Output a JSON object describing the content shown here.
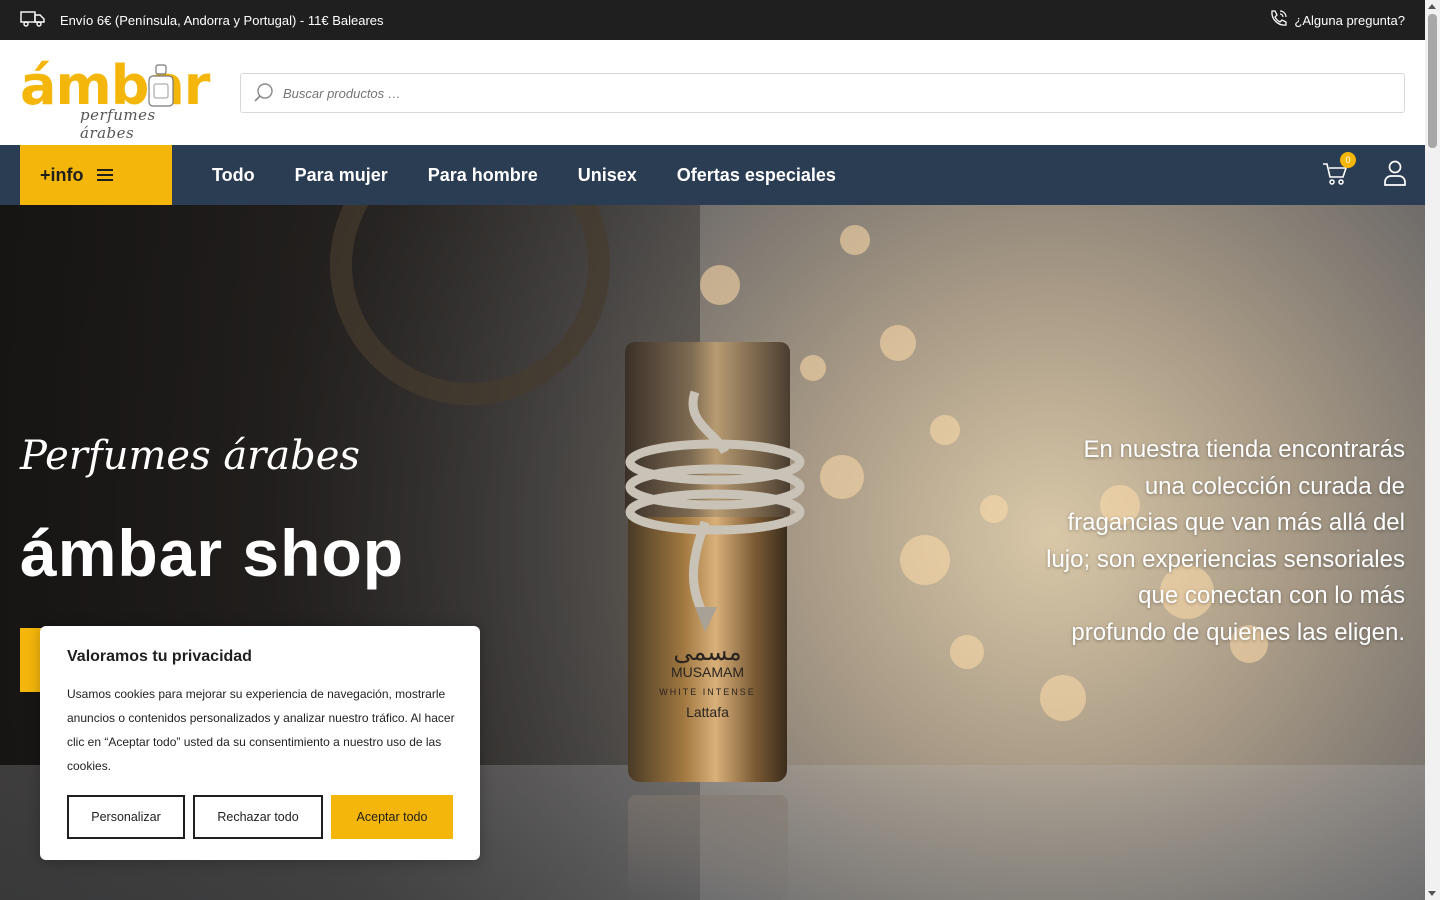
{
  "topbar": {
    "shipping_icon": "truck-icon",
    "shipping_text": "Envío 6€ (Península, Andorra y Portugal) - 11€ Baleares",
    "question_icon": "phone-icon",
    "question_text": "¿Alguna pregunta?"
  },
  "header": {
    "logo_word": "ámbar",
    "logo_tagline": "perfumes árabes",
    "search_placeholder": "Buscar productos …",
    "search_icon": "search-icon"
  },
  "nav": {
    "info_label": "+info",
    "menu_icon": "hamburger-icon",
    "items": [
      "Todo",
      "Para mujer",
      "Para hombre",
      "Unisex",
      "Ofertas especiales"
    ],
    "cart_count": "0",
    "cart_icon": "cart-icon",
    "user_icon": "user-icon"
  },
  "hero": {
    "script_text": "Perfumes árabes",
    "title": "ámbar shop",
    "description": "En nuestra tienda encontrarás una colección curada de fragancias que van más allá del lujo; son experiencias sensoriales que conectan con lo más profundo de quienes las eligen.",
    "bottle_brand_arabic": "مسمى",
    "bottle_brand": "MUSAMAM",
    "bottle_sub": "WHITE INTENSE",
    "bottle_maker": "Lattafa"
  },
  "cookie": {
    "title": "Valoramos tu privacidad",
    "body": "Usamos cookies para mejorar su experiencia de navegación, mostrarle anuncios o contenidos personalizados y analizar nuestro tráfico. Al hacer clic en “Aceptar todo” usted da su consentimiento a nuestro uso de las cookies.",
    "btn_customize": "Personalizar",
    "btn_reject": "Rechazar todo",
    "btn_accept": "Aceptar todo"
  },
  "colors": {
    "accent": "#f5b60c",
    "nav_bg": "#2b3d52",
    "topbar_bg": "#1f1f1f"
  }
}
